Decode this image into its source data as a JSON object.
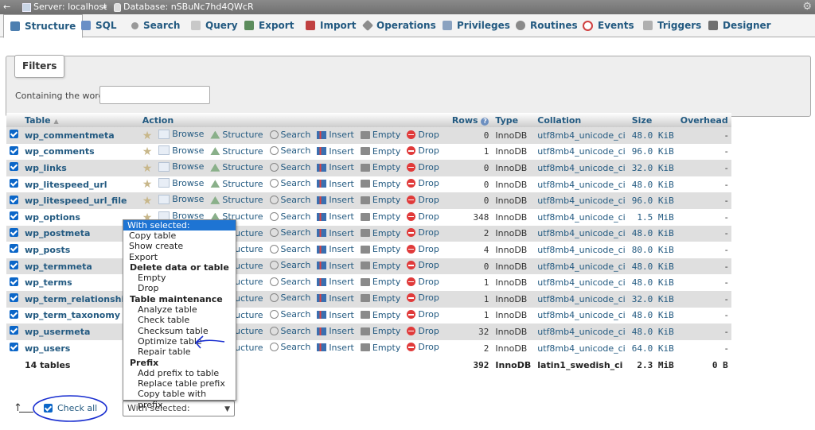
{
  "titlebar": {
    "back": "←",
    "server": "Server: localhost",
    "sep": "»",
    "database": "Database: nSBuNc7hd4QWcR"
  },
  "tabs": [
    {
      "label": "Structure",
      "icon": "structure-icon",
      "color": "#4d7fb0"
    },
    {
      "label": "SQL",
      "icon": "sql-icon",
      "color": "#6a8fc6"
    },
    {
      "label": "Search",
      "icon": "search-icon",
      "color": "#999999"
    },
    {
      "label": "Query",
      "icon": "query-icon",
      "color": "#b0b0b0"
    },
    {
      "label": "Export",
      "icon": "export-icon",
      "color": "#5c8c5c"
    },
    {
      "label": "Import",
      "icon": "import-icon",
      "color": "#c04040"
    },
    {
      "label": "Operations",
      "icon": "wrench-icon",
      "color": "#8c8c8c"
    },
    {
      "label": "Privileges",
      "icon": "privileges-icon",
      "color": "#8aa2c0"
    },
    {
      "label": "Routines",
      "icon": "routines-icon",
      "color": "#8a8a8a"
    },
    {
      "label": "Events",
      "icon": "clock-icon",
      "color": "#d04040"
    },
    {
      "label": "Triggers",
      "icon": "triggers-icon",
      "color": "#b0b0b0"
    },
    {
      "label": "Designer",
      "icon": "designer-icon",
      "color": "#707070"
    }
  ],
  "filters": {
    "legend": "Filters",
    "containing_label": "Containing the word:",
    "input_value": ""
  },
  "table": {
    "headers": {
      "table": "Table",
      "sort_glyph": "▲",
      "action": "Action",
      "rows": "Rows",
      "rows_help": "?",
      "type": "Type",
      "collation": "Collation",
      "size": "Size",
      "overhead": "Overhead"
    },
    "actions": [
      "Browse",
      "Structure",
      "Search",
      "Insert",
      "Empty",
      "Drop"
    ],
    "rows": [
      {
        "name": "wp_commentmeta",
        "rows": "0",
        "type": "InnoDB",
        "collation": "utf8mb4_unicode_ci",
        "size": "48.0 KiB",
        "overhead": "-"
      },
      {
        "name": "wp_comments",
        "rows": "1",
        "type": "InnoDB",
        "collation": "utf8mb4_unicode_ci",
        "size": "96.0 KiB",
        "overhead": "-"
      },
      {
        "name": "wp_links",
        "rows": "0",
        "type": "InnoDB",
        "collation": "utf8mb4_unicode_ci",
        "size": "32.0 KiB",
        "overhead": "-"
      },
      {
        "name": "wp_litespeed_url",
        "rows": "0",
        "type": "InnoDB",
        "collation": "utf8mb4_unicode_ci",
        "size": "48.0 KiB",
        "overhead": "-"
      },
      {
        "name": "wp_litespeed_url_file",
        "rows": "0",
        "type": "InnoDB",
        "collation": "utf8mb4_unicode_ci",
        "size": "96.0 KiB",
        "overhead": "-"
      },
      {
        "name": "wp_options",
        "rows": "348",
        "type": "InnoDB",
        "collation": "utf8mb4_unicode_ci",
        "size": "1.5 MiB",
        "overhead": "-"
      },
      {
        "name": "wp_postmeta",
        "rows": "2",
        "type": "InnoDB",
        "collation": "utf8mb4_unicode_ci",
        "size": "48.0 KiB",
        "overhead": "-"
      },
      {
        "name": "wp_posts",
        "rows": "4",
        "type": "InnoDB",
        "collation": "utf8mb4_unicode_ci",
        "size": "80.0 KiB",
        "overhead": "-"
      },
      {
        "name": "wp_termmeta",
        "rows": "0",
        "type": "InnoDB",
        "collation": "utf8mb4_unicode_ci",
        "size": "48.0 KiB",
        "overhead": "-"
      },
      {
        "name": "wp_terms",
        "rows": "1",
        "type": "InnoDB",
        "collation": "utf8mb4_unicode_ci",
        "size": "48.0 KiB",
        "overhead": "-"
      },
      {
        "name": "wp_term_relationships",
        "rows": "1",
        "type": "InnoDB",
        "collation": "utf8mb4_unicode_ci",
        "size": "32.0 KiB",
        "overhead": "-"
      },
      {
        "name": "wp_term_taxonomy",
        "rows": "1",
        "type": "InnoDB",
        "collation": "utf8mb4_unicode_ci",
        "size": "48.0 KiB",
        "overhead": "-"
      },
      {
        "name": "wp_usermeta",
        "rows": "32",
        "type": "InnoDB",
        "collation": "utf8mb4_unicode_ci",
        "size": "48.0 KiB",
        "overhead": "-"
      },
      {
        "name": "wp_users",
        "rows": "2",
        "type": "InnoDB",
        "collation": "utf8mb4_unicode_ci",
        "size": "64.0 KiB",
        "overhead": "-"
      }
    ],
    "summary": {
      "label": "14 tables",
      "rows": "392",
      "type": "InnoDB",
      "collation": "latin1_swedish_ci",
      "size": "2.3 MiB",
      "overhead": "0 B"
    }
  },
  "dropdown": {
    "selected": "With selected:",
    "items": [
      {
        "kind": "item",
        "label": "Copy table"
      },
      {
        "kind": "item",
        "label": "Show create"
      },
      {
        "kind": "item",
        "label": "Export"
      },
      {
        "kind": "group",
        "label": "Delete data or table"
      },
      {
        "kind": "indent",
        "label": "Empty"
      },
      {
        "kind": "indent",
        "label": "Drop"
      },
      {
        "kind": "group",
        "label": "Table maintenance"
      },
      {
        "kind": "indent",
        "label": "Analyze table"
      },
      {
        "kind": "indent",
        "label": "Check table"
      },
      {
        "kind": "indent",
        "label": "Checksum table"
      },
      {
        "kind": "indent",
        "label": "Optimize table"
      },
      {
        "kind": "indent",
        "label": "Repair table"
      },
      {
        "kind": "group",
        "label": "Prefix"
      },
      {
        "kind": "indent",
        "label": "Add prefix to table"
      },
      {
        "kind": "indent",
        "label": "Replace table prefix"
      },
      {
        "kind": "indent",
        "label": "Copy table with prefix"
      }
    ]
  },
  "bottom": {
    "arrow": "↑",
    "check_all": "Check all",
    "with_selected": "With selected:"
  },
  "annotation_color": "#1a2fd0"
}
